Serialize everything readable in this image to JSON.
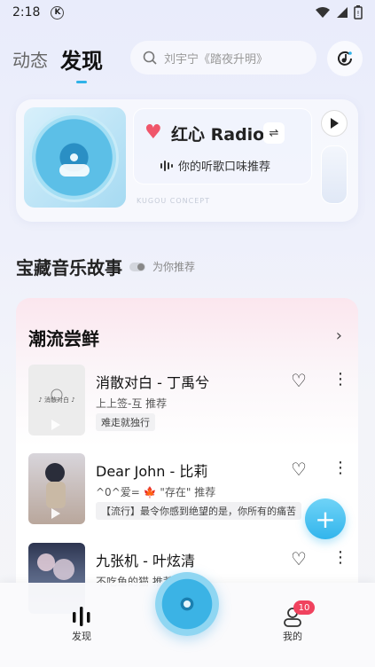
{
  "status_bar": {
    "time": "2:18",
    "k_badge": "K"
  },
  "nav": {
    "tabs": [
      "动态",
      "发现"
    ],
    "search_placeholder": "刘宇宁《踏夜升明》"
  },
  "radio": {
    "title": "红心 Radio",
    "subtitle": "你的听歌口味推荐",
    "concept": "KUGOU CONCEPT"
  },
  "section": {
    "title": "宝藏音乐故事",
    "subtitle": "为你推荐"
  },
  "list": {
    "title": "潮流尝鲜",
    "songs": [
      {
        "title": "消散对白 - 丁禹兮",
        "meta": "上上签-互 推荐",
        "tag": "难走就独行"
      },
      {
        "title": "Dear John - 比莉",
        "meta": "^0^爱= 🍁 \"存在\" 推荐",
        "tag": "【流行】最令你感到绝望的是，你所有的痛苦"
      },
      {
        "title": "九张机 - 叶炫清",
        "meta": "不吃鱼的猫 推荐",
        "tag": ""
      }
    ]
  },
  "fab": {
    "label": "+"
  },
  "bottom_nav": {
    "discover_label": "发现",
    "mine_label": "我的",
    "badge": "10"
  },
  "colors": {
    "accent": "#32b5ec",
    "heart": "#f0566b",
    "badge": "#f0425e"
  }
}
